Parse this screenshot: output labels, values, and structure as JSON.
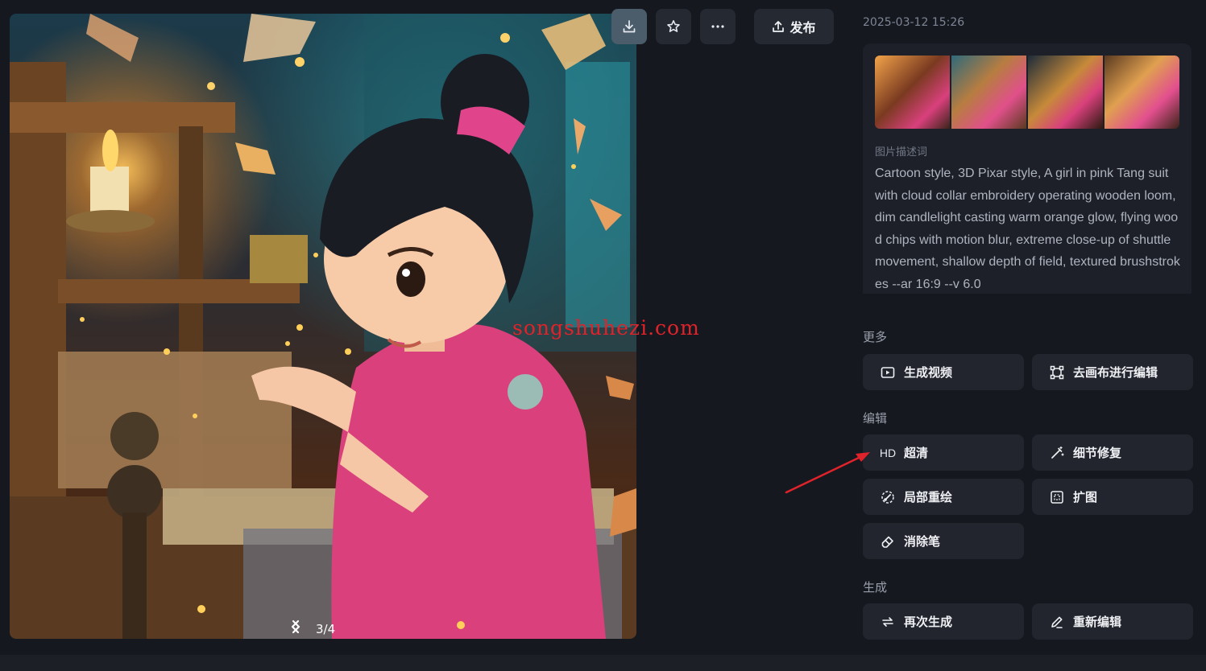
{
  "viewer": {
    "image_alt": "Cartoon girl in pink Tang suit weaving on a wooden loom by candlelight",
    "pager": {
      "current": "3/4"
    }
  },
  "toolbar": {
    "publish_label": "发布",
    "icons": [
      "download-icon",
      "star-icon",
      "more-icon",
      "upload-icon"
    ]
  },
  "watermark": "songshuhezi.com",
  "details": {
    "timestamp": "2025-03-12 15:26",
    "prompt_label": "图片描述词",
    "prompt": "Cartoon style, 3D Pixar style, A girl in pink Tang suit with cloud collar embroidery operating wooden loom, dim candlelight casting warm orange glow, flying wood chips with motion blur, extreme close-up of shuttle movement, shallow depth of field, textured brushstrokes --ar 16:9 --v 6.0"
  },
  "sections": {
    "more": {
      "title": "更多",
      "items": [
        {
          "label": "生成视频",
          "icon": "video-icon"
        },
        {
          "label": "去画布进行编辑",
          "icon": "canvas-icon"
        }
      ]
    },
    "edit": {
      "title": "编辑",
      "items": [
        {
          "label": "超清",
          "icon": "hd-icon",
          "icon_text": "HD"
        },
        {
          "label": "细节修复",
          "icon": "magic-wand-icon"
        },
        {
          "label": "局部重绘",
          "icon": "inpaint-icon"
        },
        {
          "label": "扩图",
          "icon": "expand-icon"
        },
        {
          "label": "消除笔",
          "icon": "eraser-icon"
        }
      ]
    },
    "generate": {
      "title": "生成",
      "items": [
        {
          "label": "再次生成",
          "icon": "regenerate-icon"
        },
        {
          "label": "重新编辑",
          "icon": "pencil-icon"
        }
      ]
    }
  },
  "colors": {
    "background": "#15181f",
    "button": "#22252d",
    "accent_active": "#4b5d6a",
    "annotation_arrow": "#e0232a"
  }
}
